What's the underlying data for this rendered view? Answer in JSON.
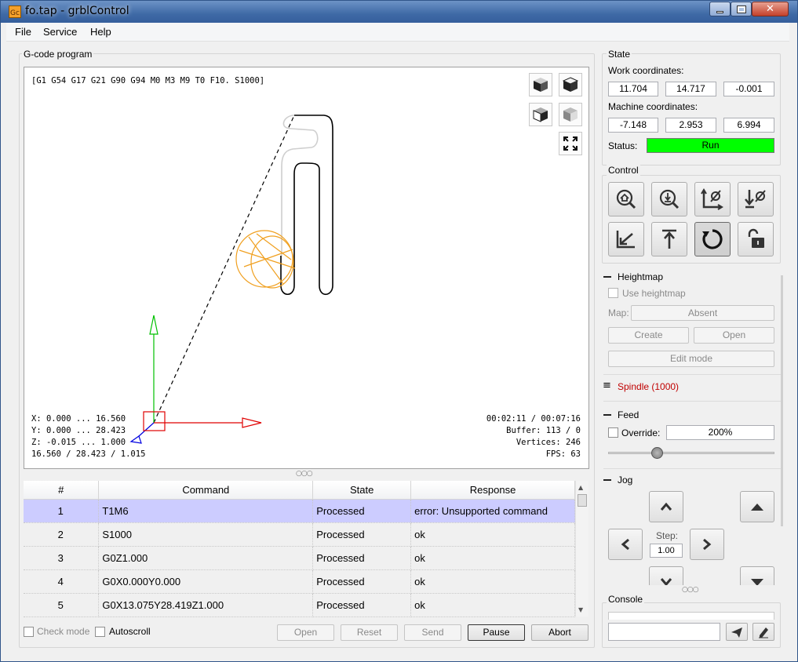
{
  "window": {
    "title": "fo.tap - grblControl",
    "icon": "grbl-app-icon"
  },
  "menu": [
    "File",
    "Service",
    "Help"
  ],
  "gcode_group": {
    "title": "G-code program",
    "modal_state": "[G1 G54 G17 G21 G90 G94 M0 M3 M9 T0 F10. S1000]",
    "bounds": [
      "X: 0.000 ... 16.560",
      "Y: 0.000 ... 28.423",
      "Z: -0.015 ... 1.000",
      "16.560 / 28.423 / 1.015"
    ],
    "stats": [
      "00:02:11 / 00:07:16",
      "Buffer: 113 / 0",
      "Vertices: 246",
      "FPS: 63"
    ],
    "view_icons": [
      "iso-view-icon",
      "top-view-icon",
      "front-view-icon",
      "left-view-icon",
      "fit-view-icon"
    ]
  },
  "table": {
    "headers": [
      "#",
      "Command",
      "State",
      "Response"
    ],
    "rows": [
      {
        "num": "1",
        "command": "T1M6",
        "state": "Processed",
        "response": "error: Unsupported command"
      },
      {
        "num": "2",
        "command": "S1000",
        "state": "Processed",
        "response": "ok"
      },
      {
        "num": "3",
        "command": "G0Z1.000",
        "state": "Processed",
        "response": "ok"
      },
      {
        "num": "4",
        "command": "G0X0.000Y0.000",
        "state": "Processed",
        "response": "ok"
      },
      {
        "num": "5",
        "command": "G0X13.075Y28.419Z1.000",
        "state": "Processed",
        "response": "ok"
      }
    ],
    "selected_row": 1
  },
  "bottom_bar": {
    "check_mode": "Check mode",
    "autoscroll": "Autoscroll",
    "open": "Open",
    "reset": "Reset",
    "send": "Send",
    "pause": "Pause",
    "abort": "Abort"
  },
  "state": {
    "title": "State",
    "work_label": "Work coordinates:",
    "work": [
      "11.704",
      "14.717",
      "-0.001"
    ],
    "machine_label": "Machine coordinates:",
    "machine": [
      "-7.148",
      "2.953",
      "6.994"
    ],
    "status_label": "Status:",
    "status": "Run",
    "status_color": "#00ff00"
  },
  "control": {
    "title": "Control",
    "buttons": [
      "home-icon",
      "probe-z-icon",
      "zero-xy-icon",
      "zero-z-icon",
      "return-xy-icon",
      "safe-z-icon",
      "reset-icon",
      "unlock-icon"
    ]
  },
  "heightmap": {
    "title": "Heightmap",
    "use_label": "Use heightmap",
    "map_label": "Map:",
    "map_value": "Absent",
    "create": "Create",
    "open": "Open",
    "edit_mode": "Edit mode"
  },
  "spindle": {
    "title": "Spindle (1000)",
    "color": "#c00000"
  },
  "feed": {
    "title": "Feed",
    "override_label": "Override:",
    "override_value": "200%",
    "slider_level": 0.28
  },
  "jog": {
    "title": "Jog",
    "step_label": "Step:",
    "step_value": "1.00"
  },
  "console": {
    "title": "Console",
    "send_icon": "send-icon",
    "clear_icon": "clear-icon"
  }
}
